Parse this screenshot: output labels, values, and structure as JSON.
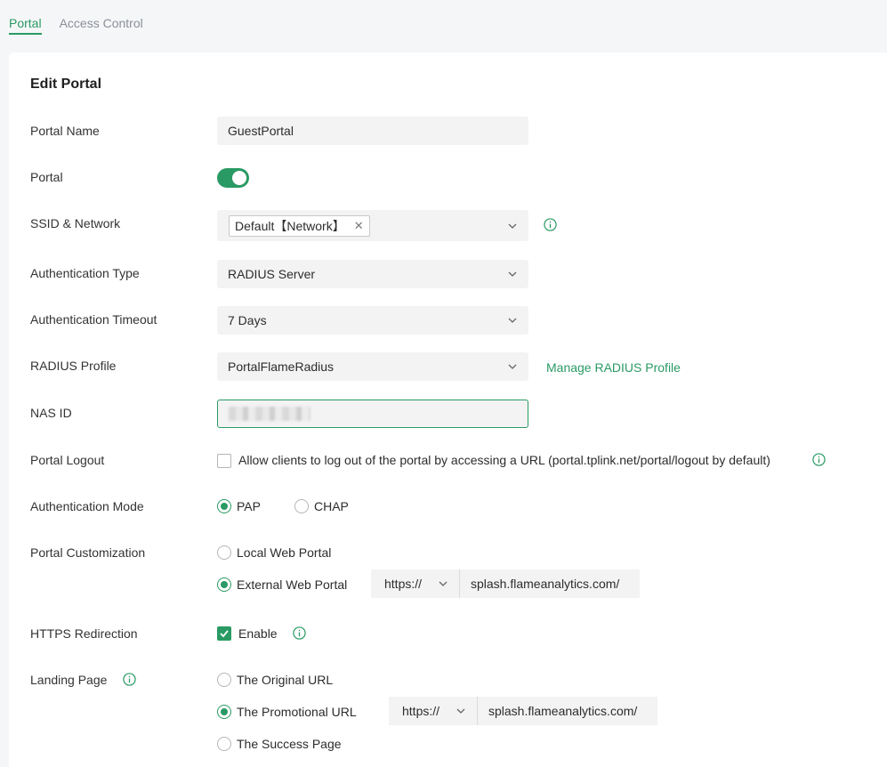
{
  "tabs": [
    {
      "label": "Portal",
      "active": true
    },
    {
      "label": "Access Control",
      "active": false
    }
  ],
  "panel_title": "Edit Portal",
  "portal_name": {
    "label": "Portal Name",
    "value": "GuestPortal"
  },
  "portal_toggle": {
    "label": "Portal",
    "enabled": true
  },
  "ssid_network": {
    "label": "SSID & Network",
    "tag": "Default【Network】"
  },
  "auth_type": {
    "label": "Authentication Type",
    "value": "RADIUS Server"
  },
  "auth_timeout": {
    "label": "Authentication Timeout",
    "value": "7 Days"
  },
  "radius_profile": {
    "label": "RADIUS Profile",
    "value": "PortalFlameRadius",
    "manage_link": "Manage RADIUS Profile"
  },
  "nas_id": {
    "label": "NAS ID"
  },
  "portal_logout": {
    "label": "Portal Logout",
    "checkbox_text": "Allow clients to log out of the portal by accessing a URL (portal.tplink.net/portal/logout by default)",
    "checked": false
  },
  "auth_mode": {
    "label": "Authentication Mode",
    "options": [
      "PAP",
      "CHAP"
    ],
    "selected": "PAP"
  },
  "portal_customization": {
    "label": "Portal Customization",
    "options": [
      "Local Web Portal",
      "External Web Portal"
    ],
    "selected": "External Web Portal",
    "protocol": "https://",
    "url": "splash.flameanalytics.com/"
  },
  "https_redirection": {
    "label": "HTTPS Redirection",
    "checkbox_text": "Enable",
    "checked": true
  },
  "landing_page": {
    "label": "Landing Page",
    "options": [
      "The Original URL",
      "The Promotional URL",
      "The Success Page"
    ],
    "selected": "The Promotional URL",
    "protocol": "https://",
    "url": "splash.flameanalytics.com/"
  },
  "colors": {
    "accent": "#2a9a64",
    "field_bg": "#f3f3f3",
    "page_bg": "#f5f6f7"
  }
}
